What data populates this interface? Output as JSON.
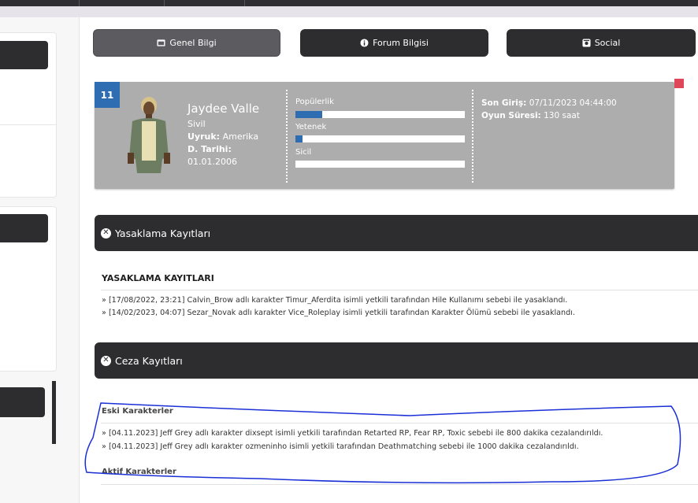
{
  "tabs": [
    {
      "label": "Genel Bilgi",
      "icon": "id-card-icon",
      "active": true
    },
    {
      "label": "Forum Bilgisi",
      "icon": "info-icon",
      "active": false
    },
    {
      "label": "Social",
      "icon": "social-box-icon",
      "active": false
    }
  ],
  "profile": {
    "level": "11",
    "name": "Jaydee Valle",
    "status": "Sivil",
    "nationality_label": "Uyruk:",
    "nationality": "Amerika",
    "birth_label": "D. Tarihi:",
    "birth": "01.01.2006",
    "stats": [
      {
        "label": "Popülerlik",
        "value": 0.16
      },
      {
        "label": "Yetenek",
        "value": 0.04
      },
      {
        "label": "Sicil",
        "value": 0
      }
    ],
    "last_login_label": "Son Giriş:",
    "last_login": "07/11/2023 04:44:00",
    "playtime_label": "Oyun Süresi:",
    "playtime": "130 saat",
    "colors": {
      "accent": "#2f6db3",
      "card": "#adadad",
      "flag": "#e0465a"
    }
  },
  "bans": {
    "section_title": "Yasaklama Kayıtları",
    "heading": "YASAKLAMA KAYITLARI",
    "records": [
      "[17/08/2022, 23:21] Calvin_Brow adlı karakter Timur_Aferdita isimli yetkili tarafından Hile Kullanımı sebebi ile yasaklandı.",
      "[14/02/2023, 04:07] Sezar_Novak adlı karakter Vice_Roleplay isimli yetkili tarafından Karakter Ölümü sebebi ile yasaklandı."
    ]
  },
  "penalties": {
    "section_title": "Ceza Kayıtları",
    "old_heading": "Eski Karakterler",
    "records": [
      "[04.11.2023] Jeff Grey adlı karakter dixsept isimli yetkili tarafından Retarted RP, Fear RP, Toxic sebebi ile 800 dakika cezalandırıldı.",
      "[04.11.2023] Jeff Grey adlı karakter ozmeninho isimli yetkili tarafından Deathmatching sebebi ile 1000 dakika cezalandırıldı."
    ],
    "active_heading": "Aktif Karakterler"
  },
  "glyphs": {
    "bullet": "»",
    "close": "✕"
  },
  "annotation_color": "#1a2fd6"
}
